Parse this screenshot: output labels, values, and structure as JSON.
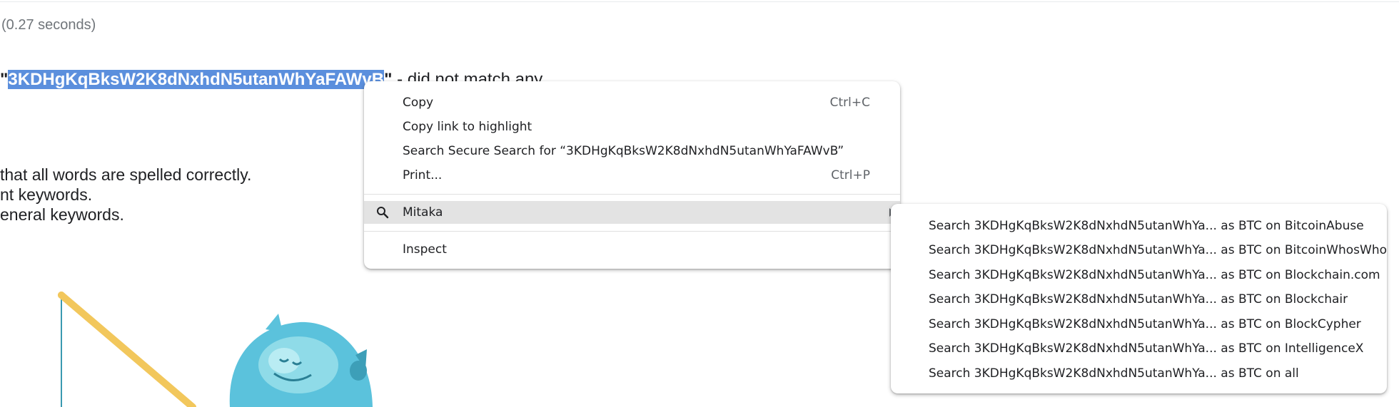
{
  "results": {
    "stats": "(0.27 seconds)",
    "query_open_quote": "\"",
    "query_selected": "3KDHgKqBksW2K8dNxhdN5utanWhYaFAWvB",
    "query_close_quote": "\"",
    "no_match_tail": " - did not match any",
    "suggestions": [
      " that all words are spelled correctly.",
      "nt keywords.",
      "eneral keywords."
    ]
  },
  "context_menu": {
    "items": [
      {
        "label": "Copy",
        "shortcut": "Ctrl+C"
      },
      {
        "label": "Copy link to highlight",
        "shortcut": ""
      },
      {
        "label": "Search Secure Search for “3KDHgKqBksW2K8dNxhdN5utanWhYaFAWvB”",
        "shortcut": ""
      },
      {
        "label": "Print...",
        "shortcut": "Ctrl+P"
      }
    ],
    "mitaka_label": "Mitaka",
    "inspect_label": "Inspect"
  },
  "submenu": {
    "items": [
      "Search 3KDHgKqBksW2K8dNxhdN5utanWhYa... as BTC on BitcoinAbuse",
      "Search 3KDHgKqBksW2K8dNxhdN5utanWhYa... as BTC on BitcoinWhosWho",
      "Search 3KDHgKqBksW2K8dNxhdN5utanWhYa... as BTC on Blockchain.com",
      "Search 3KDHgKqBksW2K8dNxhdN5utanWhYa... as BTC on Blockchair",
      "Search 3KDHgKqBksW2K8dNxhdN5utanWhYa... as BTC on BlockCypher",
      "Search 3KDHgKqBksW2K8dNxhdN5utanWhYa... as BTC on IntelligenceX",
      "Search 3KDHgKqBksW2K8dNxhdN5utanWhYa... as BTC on all"
    ]
  },
  "colors": {
    "selection": "#5b8fdd",
    "menu_hover": "#e3e3e3",
    "mascot": "#5bc2dc",
    "pole": "#f2c75c"
  },
  "icons": {
    "mitaka": "search-icon",
    "submenu_arrow": "triangle-right-icon"
  }
}
